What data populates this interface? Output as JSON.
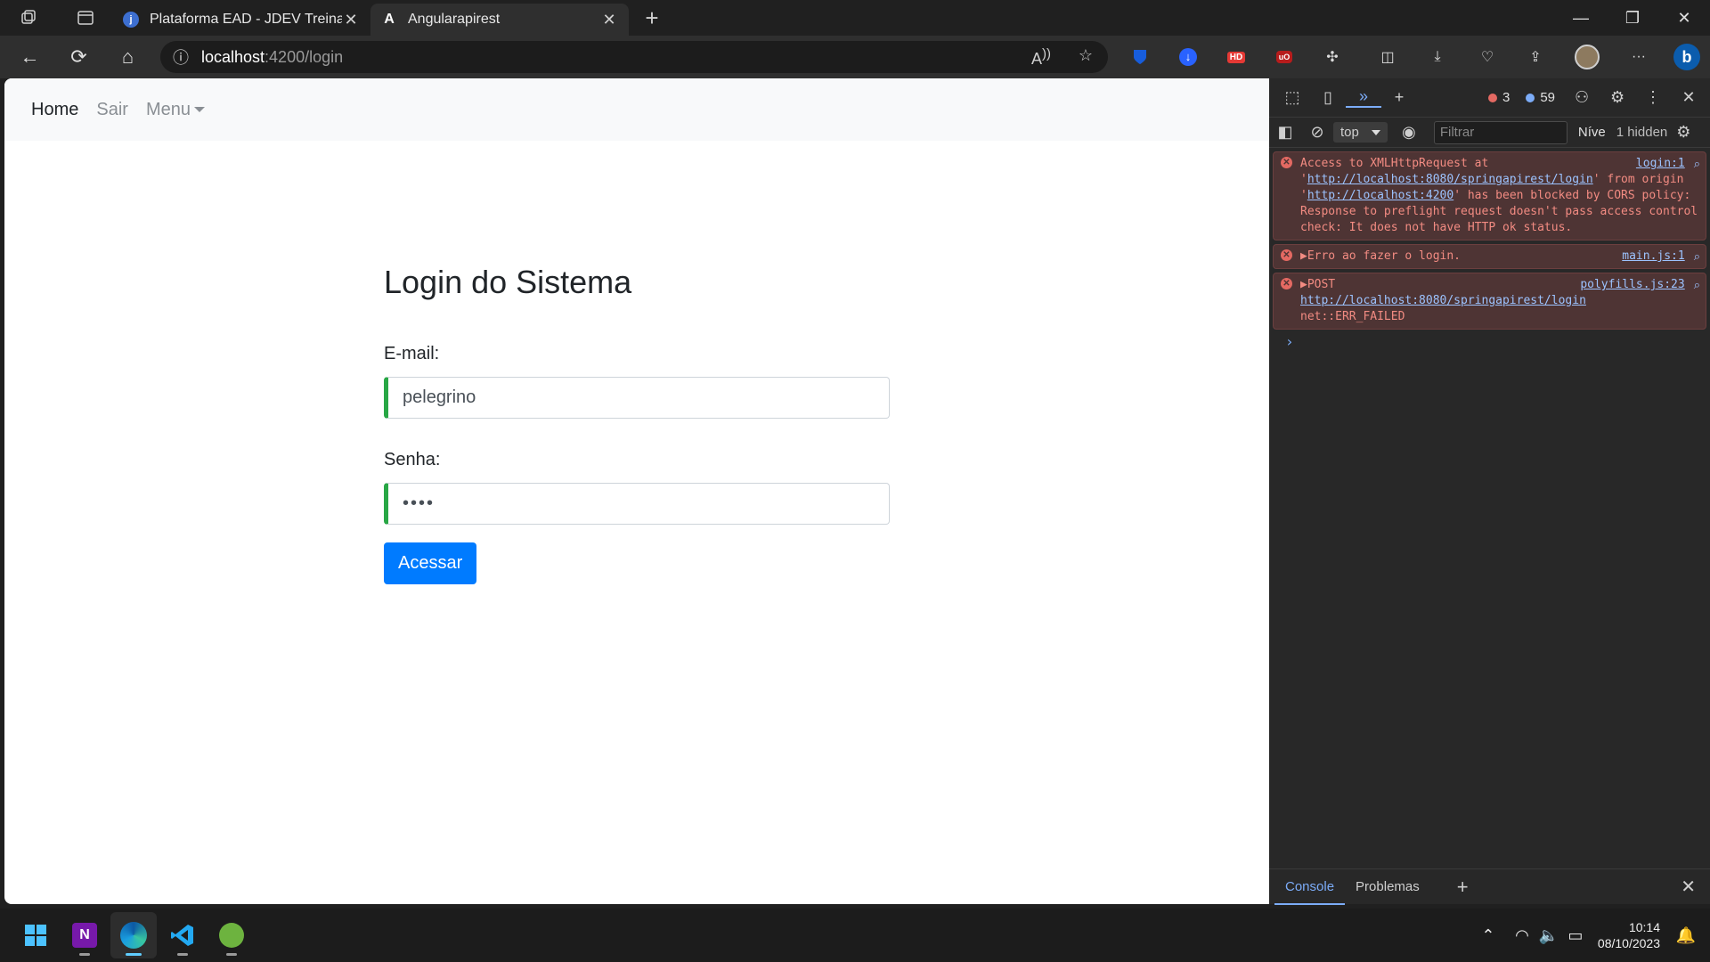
{
  "browser": {
    "tabs": [
      {
        "title": "Plataforma EAD - JDEV Treinamento",
        "active": false
      },
      {
        "title": "Angularapirest",
        "active": true
      }
    ],
    "url_host": "localhost",
    "url_path": ":4200/login",
    "extensions": [
      "bitwarden-icon",
      "download-icon",
      "hd-icon",
      "ublock-icon"
    ]
  },
  "app": {
    "nav": {
      "home": "Home",
      "sair": "Sair",
      "menu": "Menu"
    },
    "login": {
      "title": "Login do Sistema",
      "email_label": "E-mail:",
      "email_value": "pelegrino",
      "password_label": "Senha:",
      "password_value": "••••",
      "submit_label": "Acessar"
    }
  },
  "devtools": {
    "error_count": "3",
    "message_count": "59",
    "context": "top",
    "filter_placeholder": "Filtrar",
    "levels": "Níve",
    "hidden": "1 hidden",
    "messages": [
      {
        "src": "login:1",
        "text_a": "Access to XMLHttpRequest at '",
        "link_a": "http://localhost:8080/springapirest/login",
        "text_b": "' from origin '",
        "link_b": "http://localhost:4200",
        "text_c": "' has been blocked by CORS policy: Response to preflight request doesn't pass access control check: It does not have HTTP ok status."
      },
      {
        "src": "main.js:1",
        "text": "▶Erro ao fazer o login."
      },
      {
        "src": "polyfills.js:23",
        "method": "▶POST ",
        "link": "http://localhost:8080/springapirest/login",
        "text": "net::ERR_FAILED"
      }
    ],
    "bottom_tabs": [
      "Console",
      "Problemas"
    ]
  },
  "taskbar": {
    "time": "10:14",
    "date": "08/10/2023"
  },
  "colors": {
    "primary_button": "#007bff",
    "valid_border": "#28a745",
    "error_text": "#f28b82"
  }
}
